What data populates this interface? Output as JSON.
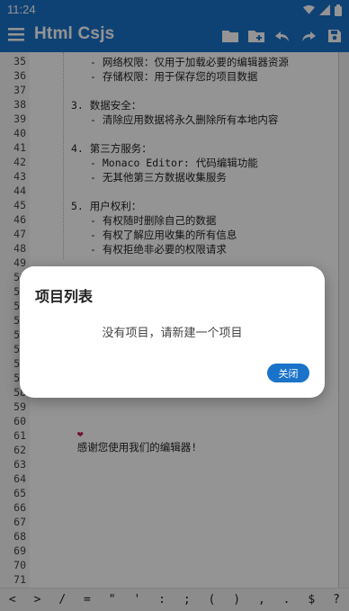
{
  "status_bar": {
    "time": "11:24"
  },
  "app_bar": {
    "title": "Html Csjs",
    "actions": [
      "folder-icon",
      "new-folder-icon",
      "undo-icon",
      "redo-icon",
      "save-icon"
    ]
  },
  "editor": {
    "line_numbers": [
      "35",
      "36",
      "37",
      "38",
      "39",
      "40",
      "41",
      "42",
      "43",
      "44",
      "45",
      "46",
      "47",
      "48",
      "49",
      "50",
      "51",
      "52",
      "53",
      "54",
      "55",
      "56",
      "57",
      "58",
      "59",
      "60",
      "61",
      "62",
      "63",
      "64",
      "65",
      "66",
      "67",
      "68",
      "69",
      "70",
      "71"
    ],
    "code_lines": [
      {
        "line": "35",
        "text": "- 网络权限：仅用于加载必要的编辑器资源"
      },
      {
        "line": "36",
        "text": "- 存储权限：用于保存您的项目数据"
      },
      {
        "line": "38",
        "text": "3. 数据安全："
      },
      {
        "line": "39",
        "text": "- 清除应用数据将永久删除所有本地内容"
      },
      {
        "line": "41",
        "text": "4. 第三方服务："
      },
      {
        "line": "42",
        "text": "- Monaco Editor: 代码编辑功能"
      },
      {
        "line": "43",
        "text": "- 无其他第三方数据收集服务"
      },
      {
        "line": "45",
        "text": "5. 用户权利："
      },
      {
        "line": "46",
        "text": "- 有权随时删除自己的数据"
      },
      {
        "line": "47",
        "text": "- 有权了解应用收集的所有信息"
      },
      {
        "line": "48",
        "text": "- 有权拒绝非必要的权限请求"
      },
      {
        "line": "60",
        "text": "感谢您使用我们的编辑器!"
      }
    ],
    "heart_glyph": "❤"
  },
  "keybar": {
    "keys": [
      "<",
      ">",
      "/",
      "=",
      "\"",
      "'",
      ":",
      ";",
      "(",
      ")",
      ",",
      ".",
      "$",
      "?"
    ]
  },
  "dialog": {
    "title": "项目列表",
    "message": "没有项目，请新建一个项目",
    "close_label": "关闭"
  },
  "colors": {
    "primary": "#1a73c9",
    "heart": "#c2185b"
  }
}
